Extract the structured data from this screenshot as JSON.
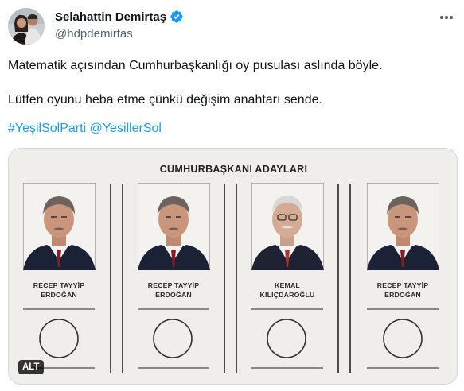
{
  "author": {
    "display_name": "Selahattin Demirtaş",
    "handle": "@hdpdemirtas",
    "verified_icon": "verified-badge-icon",
    "avatar_icon": "avatar-photo"
  },
  "post": {
    "line1": "Matematik açısından Cumhurbaşkanlığı oy pusulası aslında böyle.",
    "line2": "Lütfen oyunu heba etme çünkü değişim anahtarı sende.",
    "hashtag": "#YeşilSolParti",
    "mention": "@YesillerSol"
  },
  "media": {
    "ballot_title": "CUMHURBAŞKANI ADAYLARI",
    "candidates": [
      {
        "line1": "RECEP TAYYİP",
        "line2": "ERDOĞAN"
      },
      {
        "line1": "RECEP TAYYİP",
        "line2": "ERDOĞAN"
      },
      {
        "line1": "KEMAL",
        "line2": "KILIÇDAROĞLU"
      },
      {
        "line1": "RECEP TAYYİP",
        "line2": "ERDOĞAN"
      }
    ],
    "alt_label": "ALT"
  },
  "colors": {
    "link": "#1d9bf0",
    "verified": "#1d9bf0",
    "secondary_text": "#536471"
  }
}
